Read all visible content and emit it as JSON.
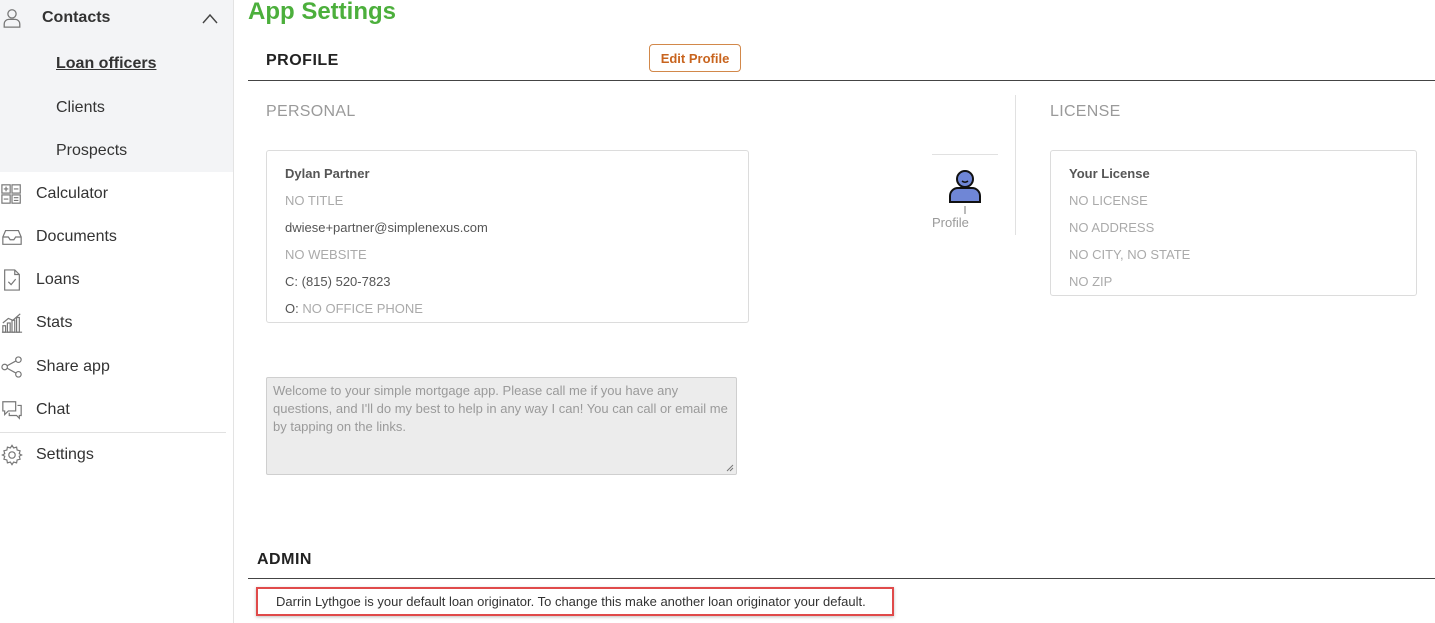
{
  "sidebar": {
    "contacts": {
      "label": "Contacts",
      "icon": "person-icon",
      "expanded": true,
      "items": [
        {
          "label": "Loan officers",
          "active": true
        },
        {
          "label": "Clients",
          "active": false
        },
        {
          "label": "Prospects",
          "active": false
        }
      ]
    },
    "items": [
      {
        "label": "Calculator",
        "icon": "calculator-icon"
      },
      {
        "label": "Documents",
        "icon": "inbox-icon"
      },
      {
        "label": "Loans",
        "icon": "document-check-icon"
      },
      {
        "label": "Stats",
        "icon": "bar-chart-icon"
      },
      {
        "label": "Share app",
        "icon": "share-icon"
      },
      {
        "label": "Chat",
        "icon": "chat-icon"
      },
      {
        "label": "Settings",
        "icon": "gear-icon"
      }
    ]
  },
  "main": {
    "title": "App Settings",
    "profile": {
      "heading": "PROFILE",
      "edit_button": "Edit Profile",
      "personal_heading": "PERSONAL",
      "license_heading": "LICENSE",
      "personal": {
        "name": "Dylan Partner",
        "title": "NO TITLE",
        "email": "dwiese+partner@simplenexus.com",
        "website": "NO WEBSITE",
        "cell_prefix": "C:",
        "cell": "(815) 520-7823",
        "office_prefix": "O:",
        "office": "NO OFFICE PHONE"
      },
      "profile_image_label": "Profile",
      "license": {
        "title": "Your License",
        "license": "NO LICENSE",
        "address": "NO ADDRESS",
        "city_state": "NO CITY, NO STATE",
        "zip": "NO ZIP"
      },
      "bio": "Welcome to your simple mortgage app. Please call me if you have any questions, and I'll do my best to help in any way I can! You can call or email me by tapping on the links."
    },
    "admin": {
      "heading": "ADMIN",
      "message": "Darrin Lythgoe is your default loan originator. To change this make another loan originator your default."
    }
  },
  "colors": {
    "title_green": "#4caf3c",
    "edit_orange": "#c8641e",
    "highlight_red": "#e04a4a",
    "sidebar_group_bg": "#f3f4f6",
    "avatar_blue": "#6f86d6"
  }
}
